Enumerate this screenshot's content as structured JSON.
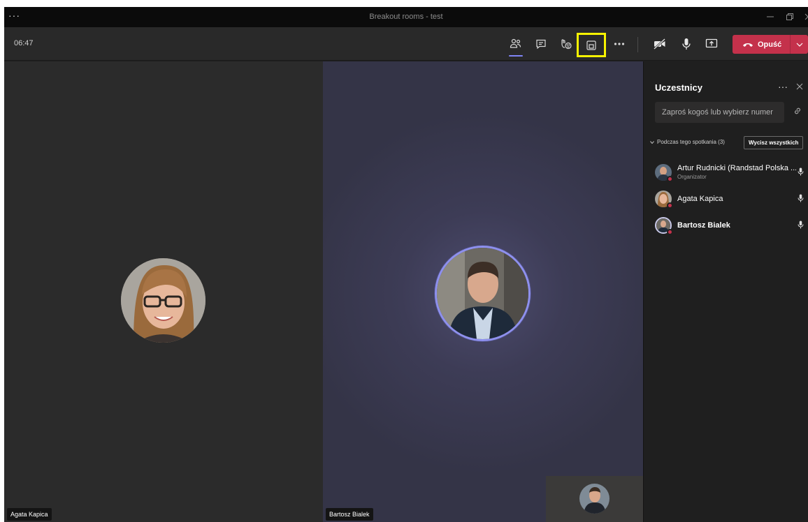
{
  "window": {
    "title": "Breakout rooms - test",
    "menu_icon": "more-icon",
    "controls": [
      "minimize-icon",
      "restore-icon",
      "close-icon"
    ]
  },
  "toolbar": {
    "timer": "06:47",
    "buttons": [
      {
        "icon": "participants-icon",
        "active": true
      },
      {
        "icon": "chat-icon"
      },
      {
        "icon": "reactions-icon"
      },
      {
        "icon": "rooms-icon",
        "highlighted": true
      },
      {
        "icon": "more-icon"
      },
      {
        "icon": "camera-off-icon"
      },
      {
        "icon": "microphone-icon"
      },
      {
        "icon": "share-screen-icon"
      }
    ],
    "leave_label": "Opuść",
    "highlight_color": "#f7f200",
    "leave_color": "#c4314b",
    "accent_color": "#7f85f5"
  },
  "stage": {
    "tiles": [
      {
        "name": "Agata Kapica"
      },
      {
        "name": "Bartosz Bialek",
        "speaking": true
      }
    ]
  },
  "panel": {
    "title": "Uczestnicy",
    "invite_placeholder": "Zaproś kogoś lub wybierz numer",
    "section_label": "Podczas tego spotkania (3)",
    "mute_all_label": "Wycisz wszystkich",
    "participants": [
      {
        "name": "Artur Rudnicki (Randstad Polska ...",
        "role": "Organizator"
      },
      {
        "name": "Agata Kapica",
        "role": ""
      },
      {
        "name": "Bartosz Bialek",
        "role": ""
      }
    ]
  }
}
